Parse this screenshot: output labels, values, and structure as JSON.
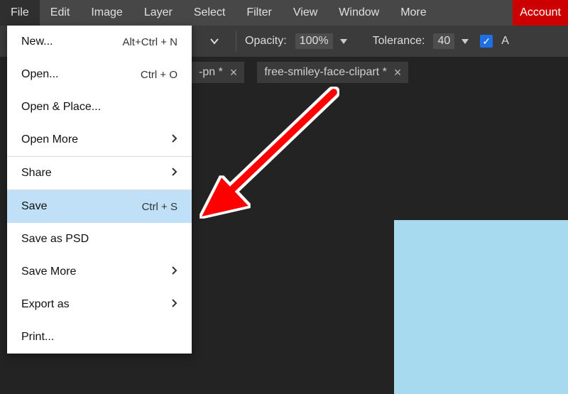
{
  "menubar": {
    "items": [
      "File",
      "Edit",
      "Image",
      "Layer",
      "Select",
      "Filter",
      "View",
      "Window",
      "More"
    ],
    "account": "Account",
    "active_index": 0
  },
  "options": {
    "opacity_label": "Opacity:",
    "opacity_value": "100%",
    "tolerance_label": "Tolerance:",
    "tolerance_value": "40",
    "checkbox_checked": true,
    "trailing_letter": "A"
  },
  "tabs": [
    {
      "label": "-pn *",
      "closeable": true
    },
    {
      "label": "free-smiley-face-clipart *",
      "closeable": true
    }
  ],
  "file_menu": {
    "groups": [
      [
        {
          "label": "New...",
          "shortcut": "Alt+Ctrl + N"
        },
        {
          "label": "Open...",
          "shortcut": "Ctrl + O"
        },
        {
          "label": "Open & Place..."
        },
        {
          "label": "Open More",
          "submenu": true
        }
      ],
      [
        {
          "label": "Share",
          "submenu": true
        }
      ],
      [
        {
          "label": "Save",
          "shortcut": "Ctrl + S",
          "highlight": true
        },
        {
          "label": "Save as PSD"
        },
        {
          "label": "Save More",
          "submenu": true
        },
        {
          "label": "Export as",
          "submenu": true
        },
        {
          "label": "Print..."
        }
      ]
    ]
  }
}
